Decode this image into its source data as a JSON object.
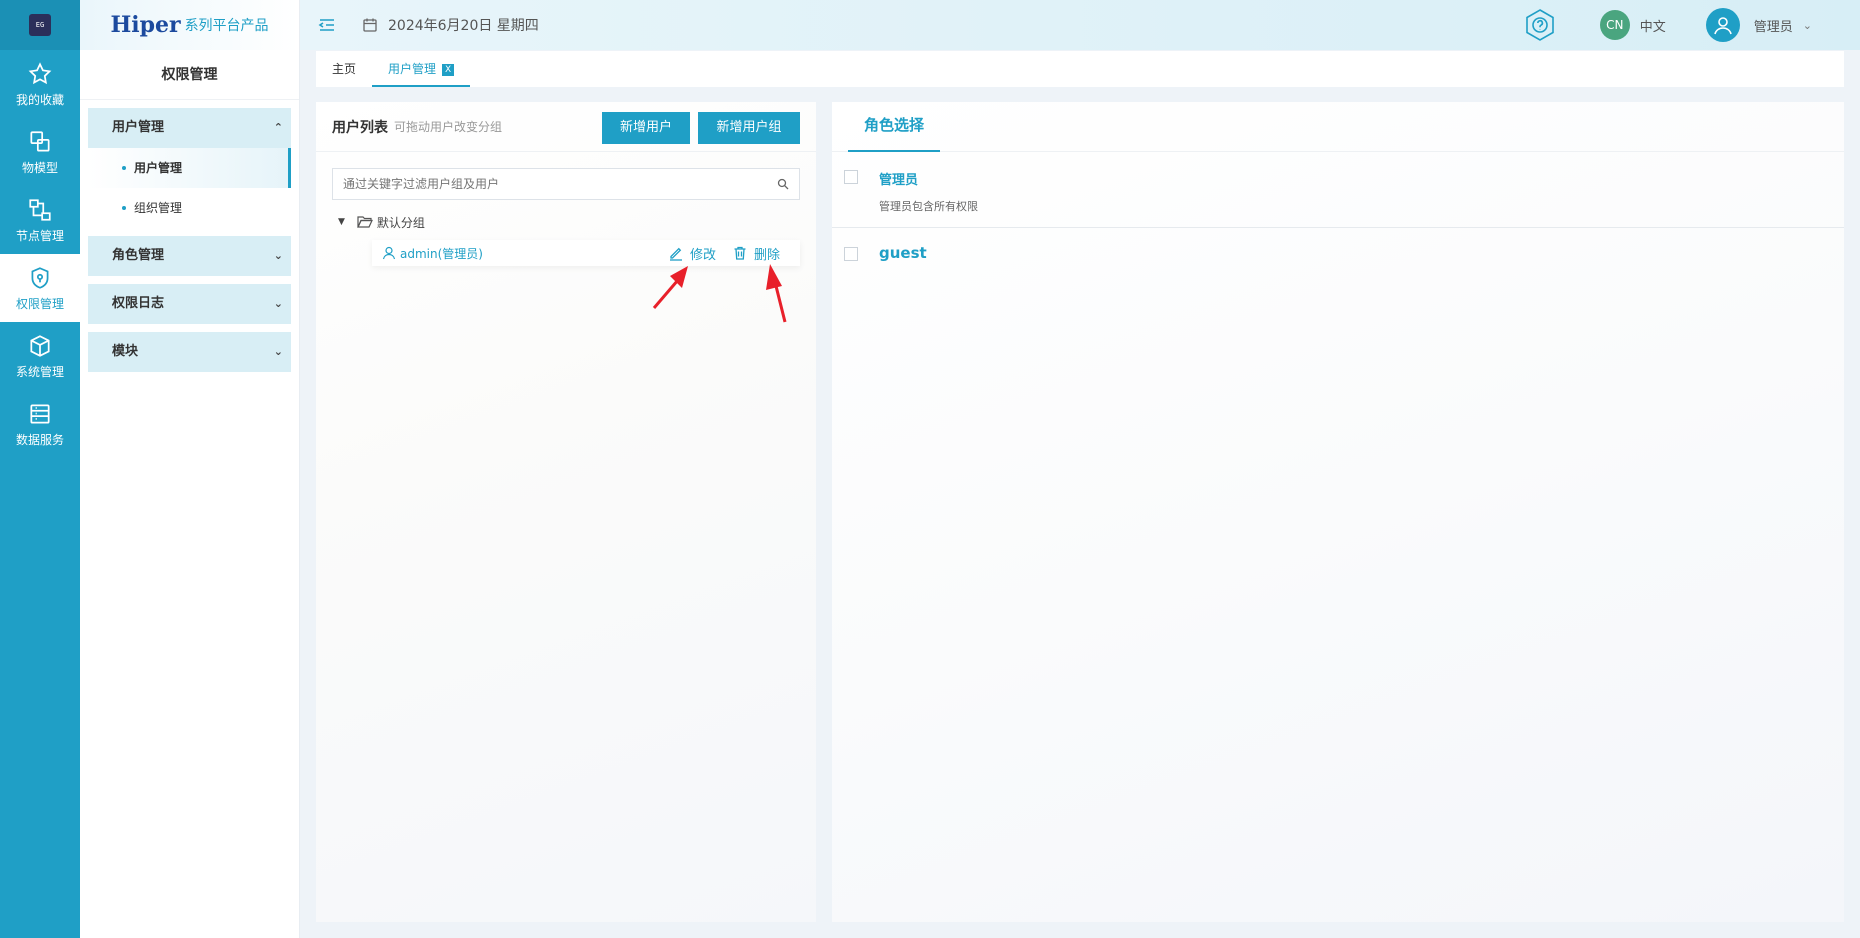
{
  "rail": {
    "logo_text": "EG",
    "items": [
      {
        "label": "我的收藏"
      },
      {
        "label": "物模型"
      },
      {
        "label": "节点管理"
      },
      {
        "label": "权限管理"
      },
      {
        "label": "系统管理"
      },
      {
        "label": "数据服务"
      }
    ]
  },
  "brand": {
    "main": "Hiper",
    "sub": "系列平台产品"
  },
  "sidebar": {
    "title": "权限管理",
    "groups": [
      {
        "label": "用户管理",
        "children": [
          {
            "label": "用户管理"
          },
          {
            "label": "组织管理"
          }
        ]
      },
      {
        "label": "角色管理"
      },
      {
        "label": "权限日志"
      },
      {
        "label": "模块"
      }
    ]
  },
  "header": {
    "date": "2024年6月20日 星期四",
    "lang_badge": "CN",
    "lang": "中文",
    "user": "管理员"
  },
  "tabs": [
    {
      "label": "主页"
    },
    {
      "label": "用户管理",
      "close": "X"
    }
  ],
  "user_list": {
    "title": "用户列表",
    "hint": "可拖动用户改变分组",
    "add_user": "新增用户",
    "add_group": "新增用户组",
    "search_placeholder": "通过关键字过滤用户组及用户",
    "group": "默认分组",
    "user": "admin(管理员)",
    "edit": "修改",
    "delete": "删除"
  },
  "role_panel": {
    "tab": "角色选择",
    "roles": [
      {
        "name": "管理员",
        "desc": "管理员包含所有权限"
      },
      {
        "name": "guest"
      }
    ]
  },
  "colors": {
    "accent": "#1f9fc6",
    "annotation": "#e8202a"
  }
}
